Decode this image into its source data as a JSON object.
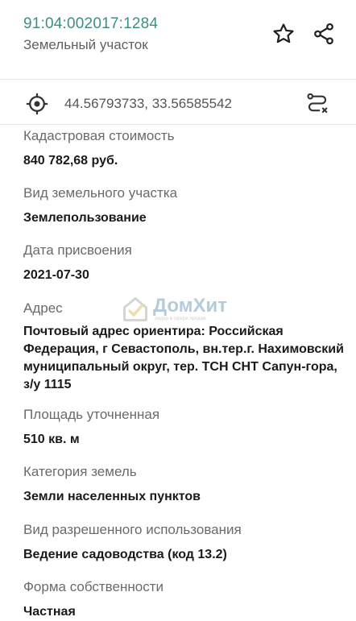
{
  "header": {
    "cadastral_number": "91:04:002017:1284",
    "object_type": "Земельный участок",
    "favorite_icon": "star-outline-icon",
    "share_icon": "share-icon"
  },
  "coords": {
    "value": "44.56793733, 33.56585542",
    "locate_icon": "crosshair-target-icon",
    "route_icon": "route-icon"
  },
  "fields": [
    {
      "label": "Кадастровая стоимость",
      "value": "840 782,68 руб."
    },
    {
      "label": "Вид земельного участка",
      "value": "Землепользование"
    },
    {
      "label": "Дата присвоения",
      "value": "2021-07-30"
    },
    {
      "label": "Адрес",
      "value": "Почтовый адрес ориентира: Российская Федерация, г Севастополь, вн.тер.г. Нахимовский муниципальный округ, тер. ТСН СНТ Сапун-гора, з/у 1115"
    },
    {
      "label": "Площадь уточненная",
      "value": "510 кв. м"
    },
    {
      "label": "Категория земель",
      "value": "Земли населенных пунктов"
    },
    {
      "label": "Вид разрешенного использования",
      "value": "Ведение садоводства (код 13.2)"
    },
    {
      "label": "Форма собственности",
      "value": "Частная"
    }
  ],
  "watermark": {
    "brand": "ДомХит",
    "tagline": "лидер в сфере продаж",
    "logo_icon": "house-check-logo"
  },
  "colors": {
    "accent": "#3d8f86",
    "label": "#6a6a6a",
    "value": "#1a1a1a"
  }
}
